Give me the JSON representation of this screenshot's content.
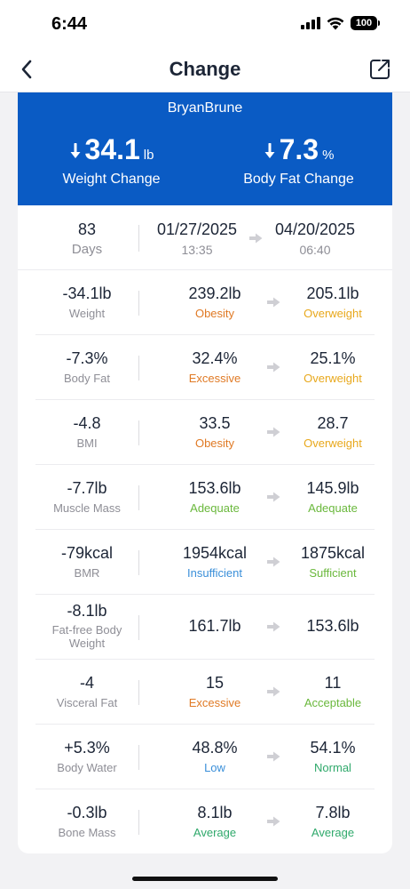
{
  "status_bar": {
    "time": "6:44",
    "battery": "100"
  },
  "nav": {
    "title": "Change"
  },
  "banner": {
    "user": "BryanBrune",
    "weight_change": {
      "value": "34.1",
      "unit": "lb",
      "label": "Weight Change"
    },
    "body_fat_change": {
      "value": "7.3",
      "unit": "%",
      "label": "Body Fat Change"
    }
  },
  "period": {
    "days": "83",
    "days_label": "Days",
    "start_date": "01/27/2025",
    "start_time": "13:35",
    "end_date": "04/20/2025",
    "end_time": "06:40"
  },
  "colors": {
    "brand": "#0a5bc4",
    "Obesity": "#e07a25",
    "Overweight": "#e8a81c",
    "Excessive": "#e07a25",
    "Adequate": "#6ab83c",
    "Insufficient": "#3a8fd9",
    "Sufficient": "#6ab83c",
    "Acceptable": "#6ab83c",
    "Low": "#3a8fd9",
    "Normal": "#2fa96b",
    "Average": "#2fa96b"
  },
  "metrics": [
    {
      "change": "-34.1lb",
      "label": "Weight",
      "start": "239.2lb",
      "start_status": "Obesity",
      "end": "205.1lb",
      "end_status": "Overweight"
    },
    {
      "change": "-7.3%",
      "label": "Body Fat",
      "start": "32.4%",
      "start_status": "Excessive",
      "end": "25.1%",
      "end_status": "Overweight"
    },
    {
      "change": "-4.8",
      "label": "BMI",
      "start": "33.5",
      "start_status": "Obesity",
      "end": "28.7",
      "end_status": "Overweight"
    },
    {
      "change": "-7.7lb",
      "label": "Muscle Mass",
      "start": "153.6lb",
      "start_status": "Adequate",
      "end": "145.9lb",
      "end_status": "Adequate"
    },
    {
      "change": "-79kcal",
      "label": "BMR",
      "start": "1954kcal",
      "start_status": "Insufficient",
      "end": "1875kcal",
      "end_status": "Sufficient"
    },
    {
      "change": "-8.1lb",
      "label": "Fat-free Body Weight",
      "start": "161.7lb",
      "start_status": "",
      "end": "153.6lb",
      "end_status": ""
    },
    {
      "change": "-4",
      "label": "Visceral Fat",
      "start": "15",
      "start_status": "Excessive",
      "end": "11",
      "end_status": "Acceptable"
    },
    {
      "change": "+5.3%",
      "label": "Body Water",
      "start": "48.8%",
      "start_status": "Low",
      "end": "54.1%",
      "end_status": "Normal"
    },
    {
      "change": "-0.3lb",
      "label": "Bone Mass",
      "start": "8.1lb",
      "start_status": "Average",
      "end": "7.8lb",
      "end_status": "Average"
    }
  ]
}
